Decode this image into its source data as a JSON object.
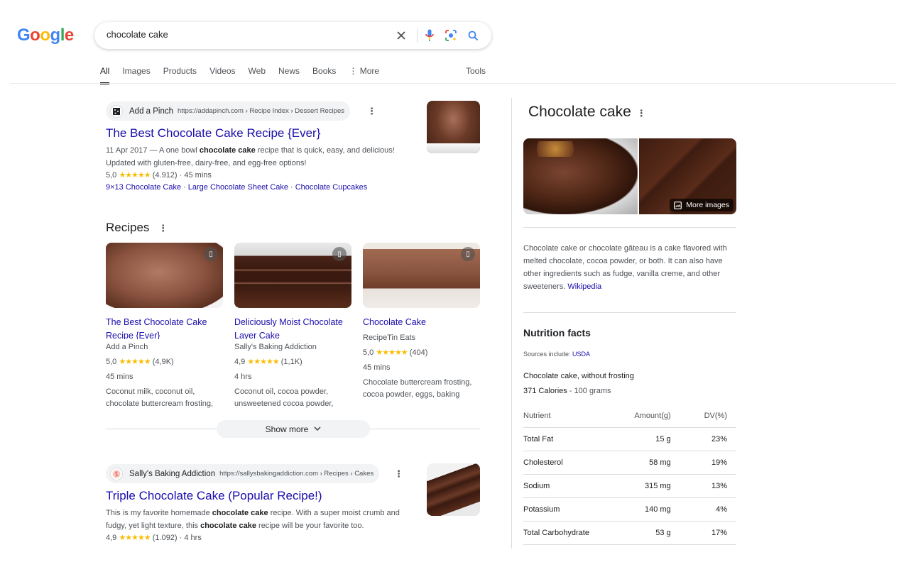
{
  "logo": {
    "g1": "G",
    "o1": "o",
    "o2": "o",
    "g2": "g",
    "l": "l",
    "e": "e"
  },
  "search": {
    "query": "chocolate cake"
  },
  "tabs": [
    {
      "label": "All",
      "active": true
    },
    {
      "label": "Images"
    },
    {
      "label": "Products"
    },
    {
      "label": "Videos"
    },
    {
      "label": "Web"
    },
    {
      "label": "News"
    },
    {
      "label": "Books"
    },
    {
      "label": "⋮ More"
    }
  ],
  "tools_label": "Tools",
  "result1": {
    "site_name": "Add a Pinch",
    "url": "https://addapinch.com › Recipe Index › Dessert Recipes",
    "title": "The Best Chocolate Cake Recipe {Ever}",
    "date": "11 Apr 2017",
    "snippet_pre": " — A one bowl ",
    "snippet_bold": "chocolate cake",
    "snippet_post": " recipe that is quick, easy, and delicious! Updated with gluten-free, dairy-free, and egg-free options!",
    "rating": "5,0",
    "stars": "★★★★★",
    "reviews": "(4.912)",
    "time": "· 45 mins",
    "sitelinks": [
      "9×13 Chocolate Cake",
      "Large Chocolate Sheet Cake",
      "Chocolate Cupcakes"
    ],
    "sitelink_sep": "·"
  },
  "recipes": {
    "title": "Recipes",
    "cards": [
      {
        "title": "The Best Chocolate Cake Recipe {Ever}",
        "source": "Add a Pinch",
        "rating": "5,0",
        "stars": "★★★★★",
        "reviews": "(4,9K)",
        "time": "45 mins",
        "ingredients": "Coconut milk, coconut oil, chocolate buttercream frosting,"
      },
      {
        "title": "Deliciously Moist Chocolate Layer Cake",
        "source": "Sally's Baking Addiction",
        "rating": "4,9",
        "stars": "★★★★★",
        "reviews": "(1,1K)",
        "time": "4 hrs",
        "ingredients": "Coconut oil, cocoa powder, unsweetened cocoa powder,"
      },
      {
        "title": "Chocolate Cake",
        "source": "RecipeTin Eats",
        "rating": "5,0",
        "stars": "★★★★★",
        "reviews": "(404)",
        "time": "45 mins",
        "ingredients": "Chocolate buttercream frosting, cocoa powder, eggs, baking"
      }
    ],
    "show_more": "Show more"
  },
  "result2": {
    "site_name": "Sally's Baking Addiction",
    "url": "https://sallysbakingaddiction.com › Recipes › Cakes",
    "title": "Triple Chocolate Cake (Popular Recipe!)",
    "snippet_1": "This is my favorite homemade ",
    "snippet_b1": "chocolate cake",
    "snippet_2": " recipe. With a super moist crumb and fudgy, yet light texture, this ",
    "snippet_b2": "chocolate cake",
    "snippet_3": " recipe will be your favorite too.",
    "rating": "4,9",
    "stars": "★★★★★",
    "reviews": "(1.092)",
    "time": "· 4 hrs"
  },
  "knowledge_panel": {
    "title": "Chocolate cake",
    "more_images": "More images",
    "description": "Chocolate cake or chocolate gâteau is a cake flavored with melted chocolate, cocoa powder, or both. It can also have other ingredients such as fudge, vanilla creme, and other sweeteners. ",
    "source_link": "Wikipedia",
    "nutrition_title": "Nutrition facts",
    "sources_label": "Sources include: ",
    "sources_link": "USDA",
    "item_name": "Chocolate cake, without frosting",
    "calories": "371 Calories",
    "serving": " - 100 grams",
    "table_headers": [
      "Nutrient",
      "Amount(g)",
      "DV(%)"
    ],
    "rows": [
      {
        "nutrient": "Total Fat",
        "amount": "15 g",
        "dv": "23%"
      },
      {
        "nutrient": "Cholesterol",
        "amount": "58 mg",
        "dv": "19%"
      },
      {
        "nutrient": "Sodium",
        "amount": "315 mg",
        "dv": "13%"
      },
      {
        "nutrient": "Potassium",
        "amount": "140 mg",
        "dv": "4%"
      },
      {
        "nutrient": "Total Carbohydrate",
        "amount": "53 g",
        "dv": "17%"
      }
    ]
  },
  "colors": {
    "link": "#1a0dab",
    "star": "#fbbc04",
    "text": "#202124",
    "muted": "#4d5156"
  },
  "icons": [
    "clear-icon",
    "microphone-icon",
    "lens-icon",
    "search-icon",
    "kebab-icon",
    "bookmark-icon",
    "chevron-down-icon",
    "image-icon"
  ]
}
